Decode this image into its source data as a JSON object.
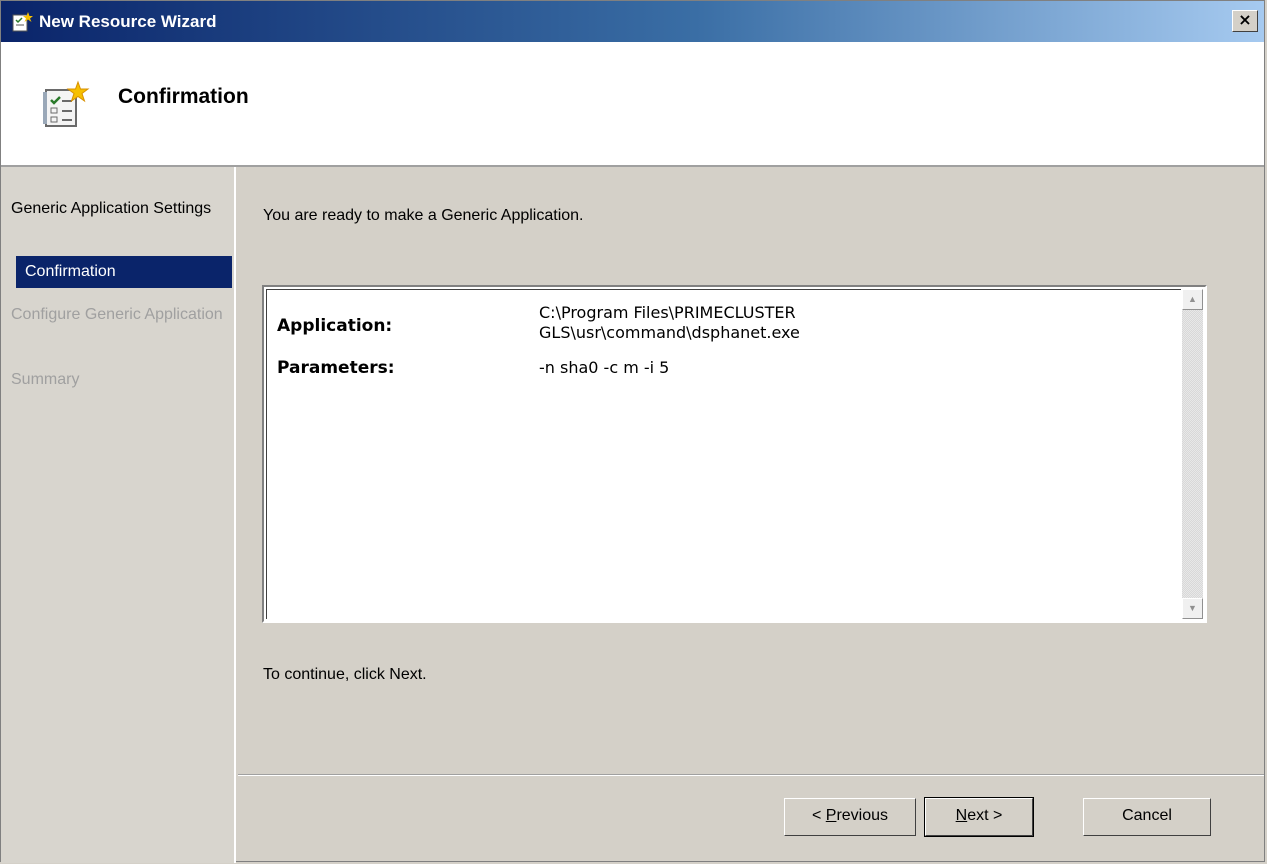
{
  "window": {
    "title": "New Resource Wizard",
    "close_label": "×"
  },
  "header": {
    "title": "Confirmation"
  },
  "nav": {
    "items": [
      {
        "label": "Generic Application Settings",
        "state": "normal"
      },
      {
        "label": "Confirmation",
        "state": "selected"
      },
      {
        "label": "Configure Generic Application",
        "state": "disabled"
      },
      {
        "label": "Summary",
        "state": "disabled"
      }
    ]
  },
  "main": {
    "intro": "You are ready to make a Generic Application.",
    "details": [
      {
        "label": "Application:",
        "value_line1": "C:\\Program Files\\PRIMECLUSTER",
        "value_line2": "GLS\\usr\\command\\dsphanet.exe"
      },
      {
        "label": "Parameters:",
        "value_line1": "-n sha0 -c m -i 5",
        "value_line2": ""
      }
    ],
    "continue_text": "To continue, click Next."
  },
  "buttons": {
    "previous": {
      "prefix": "< ",
      "accel": "P",
      "rest": "revious"
    },
    "next": {
      "accel": "N",
      "rest": "ext >"
    },
    "cancel": "Cancel"
  },
  "colors": {
    "selected_nav_bg": "#0a246a",
    "titlebar_start": "#0a246a"
  },
  "icons": {
    "window": "wizard-icon",
    "header": "wizard-checklist-icon",
    "scroll_up": "arrow-up-icon",
    "scroll_down": "arrow-down-icon"
  }
}
